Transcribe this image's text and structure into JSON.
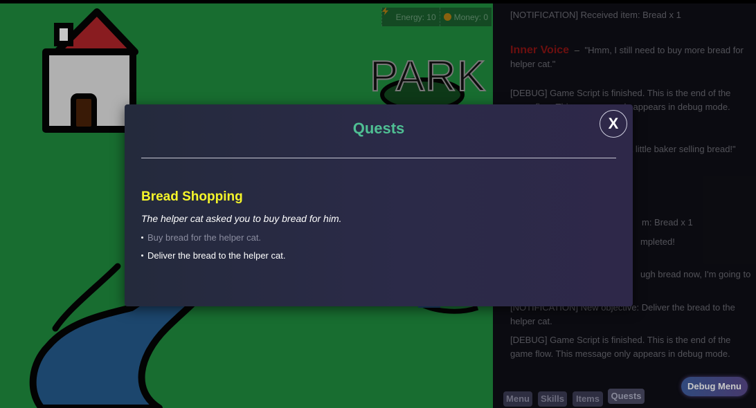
{
  "stats": {
    "energy_label": "Energy: 10",
    "money_label": "Money: 0"
  },
  "map": {
    "park_label": "PARK"
  },
  "log": [
    {
      "type": "text",
      "text": "[NOTIFICATION] Received item: Bread x 1"
    },
    {
      "type": "dialogue",
      "speaker": "Inner Voice",
      "separator": "–",
      "text": "\"Hmm, I still need to buy more bread for helper cat.\""
    },
    {
      "type": "text",
      "text": "[DEBUG] Game Script is finished. This is the end of the game flow. This message only appears in debug mode."
    },
    {
      "type": "partial",
      "text": "a little baker selling bread!\""
    },
    {
      "type": "partial",
      "text": "\""
    },
    {
      "type": "partial",
      "text": "m: Bread x 1"
    },
    {
      "type": "partial",
      "text": "mpleted!"
    },
    {
      "type": "partial",
      "text": "ugh bread now, I'm going to"
    },
    {
      "type": "text",
      "text": "[NOTIFICATION] New objective: Deliver the bread to the helper cat."
    },
    {
      "type": "text",
      "text": "[DEBUG] Game Script is finished. This is the end of the game flow. This message only appears in debug mode."
    }
  ],
  "bottom_tabs": {
    "menu": "Menu",
    "skills": "Skills",
    "items": "Items",
    "quests": "Quests"
  },
  "debug_button": "Debug Menu",
  "modal": {
    "title": "Quests",
    "close_label": "X",
    "quest": {
      "title": "Bread Shopping",
      "description": "The helper cat asked you to buy bread for him.",
      "objectives": [
        {
          "text": "Buy bread for the helper cat.",
          "completed": true
        },
        {
          "text": "Deliver the bread to the helper cat.",
          "completed": false
        }
      ]
    }
  },
  "colors": {
    "grass": "#1f8c3e",
    "river": "#245a8c",
    "modal_title": "#4fbf93",
    "quest_title": "#f5f52a",
    "speaker": "#8a1414"
  }
}
